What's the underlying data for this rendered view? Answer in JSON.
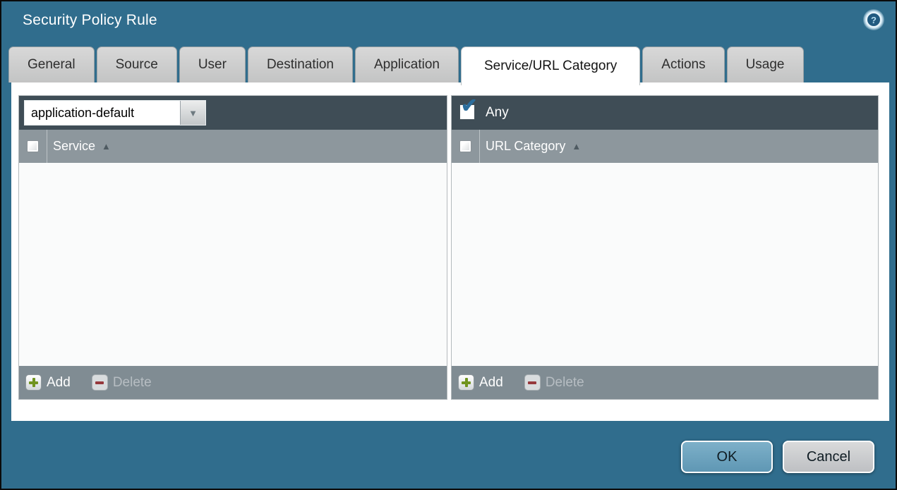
{
  "window": {
    "title": "Security Policy Rule"
  },
  "icons": {
    "help": "?",
    "dropdown_arrow": "▼",
    "sort_asc": "▲",
    "check": "✔"
  },
  "tabs": [
    {
      "label": "General",
      "active": false
    },
    {
      "label": "Source",
      "active": false
    },
    {
      "label": "User",
      "active": false
    },
    {
      "label": "Destination",
      "active": false
    },
    {
      "label": "Application",
      "active": false
    },
    {
      "label": "Service/URL Category",
      "active": true
    },
    {
      "label": "Actions",
      "active": false
    },
    {
      "label": "Usage",
      "active": false
    }
  ],
  "service_panel": {
    "dropdown": {
      "value": "application-default"
    },
    "header": {
      "label": "Service",
      "select_all_checked": false
    },
    "rows": [],
    "toolbar": {
      "add_label": "Add",
      "delete_label": "Delete",
      "delete_enabled": false
    }
  },
  "url_category_panel": {
    "any": {
      "label": "Any",
      "checked": true
    },
    "header": {
      "label": "URL Category",
      "select_all_checked": false
    },
    "rows": [],
    "toolbar": {
      "add_label": "Add",
      "delete_label": "Delete",
      "delete_enabled": false
    }
  },
  "footer": {
    "ok_label": "OK",
    "cancel_label": "Cancel"
  },
  "colors": {
    "background": "#306d8d",
    "toolbar_dark": "#3f4d56",
    "header_gray": "#8d979d",
    "footer_gray": "#808c93",
    "accent_add_green": "#70941f",
    "accent_delete_red": "#96383c",
    "check_blue": "#2b6d9c",
    "ok_button": "#6ba2bf",
    "cancel_button": "#cbccce"
  }
}
